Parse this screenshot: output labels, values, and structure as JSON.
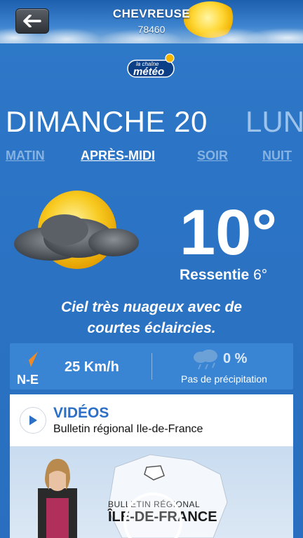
{
  "header": {
    "city": "CHEVREUSE",
    "zip": "78460",
    "back_icon": "back-arrow-icon",
    "logo_line1": "la chaîne",
    "logo_line2": "météo"
  },
  "days": {
    "current": "DIMANCHE 20",
    "next": "LUN"
  },
  "periods": [
    {
      "label": "MATIN",
      "active": false
    },
    {
      "label": "APRÈS-MIDI",
      "active": true
    },
    {
      "label": "SOIR",
      "active": false
    },
    {
      "label": "NUIT",
      "active": false
    }
  ],
  "forecast": {
    "temperature": "10°",
    "feels_label": "Ressentie",
    "feels_value": "6°",
    "description_line1": "Ciel très nuageux avec de",
    "description_line2": "courtes éclaircies.",
    "icon": "sun-behind-cloud-icon"
  },
  "wind": {
    "direction": "N-E",
    "speed": "25 Km/h",
    "icon": "wind-direction-arrow-icon"
  },
  "rain": {
    "percent": "0 %",
    "label": "Pas de précipitation",
    "icon": "rain-cloud-icon"
  },
  "videos": {
    "title": "VIDÉOS",
    "subtitle": "Bulletin régional Ile-de-France",
    "thumb_bulletin": "BULLETIN RÉGIONAL",
    "thumb_region": "ÎLE-DE-FRANCE"
  },
  "colors": {
    "background": "#2f79c9",
    "accent_orange": "#f08a24",
    "video_title_blue": "#2b6fc7"
  }
}
